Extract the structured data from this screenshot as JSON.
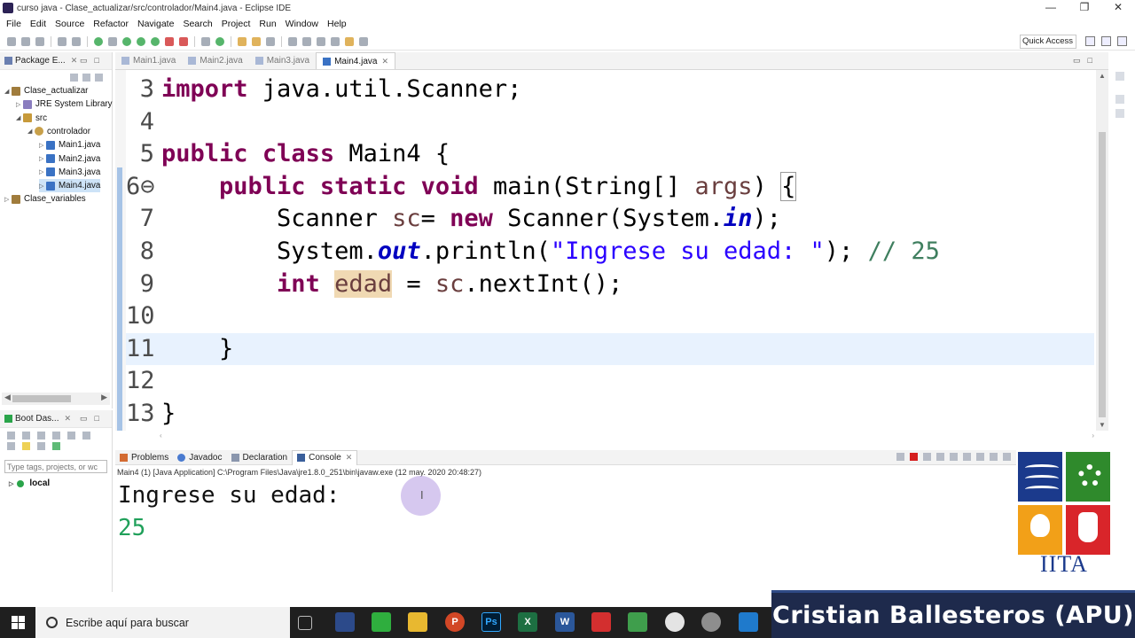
{
  "window": {
    "title": "curso java - Clase_actualizar/src/controlador/Main4.java - Eclipse IDE",
    "controls": [
      "—",
      "❐",
      "✕"
    ]
  },
  "menu": [
    "File",
    "Edit",
    "Source",
    "Refactor",
    "Navigate",
    "Search",
    "Project",
    "Run",
    "Window",
    "Help"
  ],
  "toolbar": {
    "quick_access": "Quick Access"
  },
  "package_explorer": {
    "tab_label": "Package E...",
    "tree": [
      {
        "label": "Clase_actualizar",
        "icon": "project-icon",
        "depth": 0,
        "arrow": "◢"
      },
      {
        "label": "JRE System Library",
        "icon": "library-icon",
        "depth": 1,
        "arrow": "▷"
      },
      {
        "label": "src",
        "icon": "source-folder-icon",
        "depth": 1,
        "arrow": "◢"
      },
      {
        "label": "controlador",
        "icon": "package-icon",
        "depth": 2,
        "arrow": "◢"
      },
      {
        "label": "Main1.java",
        "icon": "java-file-icon",
        "depth": 3,
        "arrow": "▷"
      },
      {
        "label": "Main2.java",
        "icon": "java-file-icon",
        "depth": 3,
        "arrow": "▷"
      },
      {
        "label": "Main3.java",
        "icon": "java-file-icon",
        "depth": 3,
        "arrow": "▷"
      },
      {
        "label": "Main4.java",
        "icon": "java-file-icon",
        "depth": 3,
        "arrow": "▷",
        "selected": true
      },
      {
        "label": "Clase_variables",
        "icon": "project-icon",
        "depth": 0,
        "arrow": "▷"
      }
    ]
  },
  "boot_dashboard": {
    "tab_label": "Boot Das...",
    "search_placeholder": "Type tags, projects, or wc",
    "local_label": "local"
  },
  "editor": {
    "tabs": [
      {
        "label": "Main1.java",
        "active": false
      },
      {
        "label": "Main2.java",
        "active": false
      },
      {
        "label": "Main3.java",
        "active": false
      },
      {
        "label": "Main4.java",
        "active": true
      }
    ],
    "lines": [
      {
        "num": "3",
        "html": "<span class=\"kw\">import</span> java.util.Scanner;"
      },
      {
        "num": "4",
        "html": ""
      },
      {
        "num": "5",
        "html": "<span class=\"kw\">public</span> <span class=\"kw\">class</span> Main4 {"
      },
      {
        "num": "6⊖",
        "html": "    <span class=\"kw\">public</span> <span class=\"kw\">static</span> <span class=\"kw\">void</span> main(String[] <span class=\"var\">args</span>) <span class=\"brk\">{</span>"
      },
      {
        "num": "7",
        "html": "        Scanner <span class=\"var\">sc</span>= <span class=\"kw\">new</span> Scanner(System.<span class=\"fld\">in</span>);"
      },
      {
        "num": "8",
        "html": "        System.<span class=\"fld\">out</span>.println(<span class=\"str\">\"Ingrese su edad: \"</span>); <span class=\"cmt\">// 25</span>"
      },
      {
        "num": "9",
        "html": "        <span class=\"kw\">int</span> <span class=\"var occ\">edad</span> = <span class=\"var\">sc</span>.nextInt();"
      },
      {
        "num": "10",
        "html": ""
      },
      {
        "num": "11",
        "html": "    }",
        "current": true
      },
      {
        "num": "12",
        "html": ""
      },
      {
        "num": "13",
        "html": "}"
      }
    ]
  },
  "console": {
    "tabs": [
      {
        "label": "Problems",
        "active": false
      },
      {
        "label": "Javadoc",
        "active": false
      },
      {
        "label": "Declaration",
        "active": false
      },
      {
        "label": "Console",
        "active": true
      }
    ],
    "info": "Main4 (1) [Java Application] C:\\Program Files\\Java\\jre1.8.0_251\\bin\\javaw.exe (12 may. 2020 20:48:27)",
    "output": "Ingrese su edad:",
    "input": "25"
  },
  "logo": {
    "text": "IITA"
  },
  "taskbar": {
    "search_text": "Escribe aquí para buscar"
  },
  "overlay": {
    "presenter": "Cristian Ballesteros (APU)"
  },
  "colors": {
    "keyword": "#7f0055",
    "string": "#2a00ff",
    "comment": "#3f7f5f",
    "field": "#0000c0",
    "console_input": "#20a05a"
  }
}
